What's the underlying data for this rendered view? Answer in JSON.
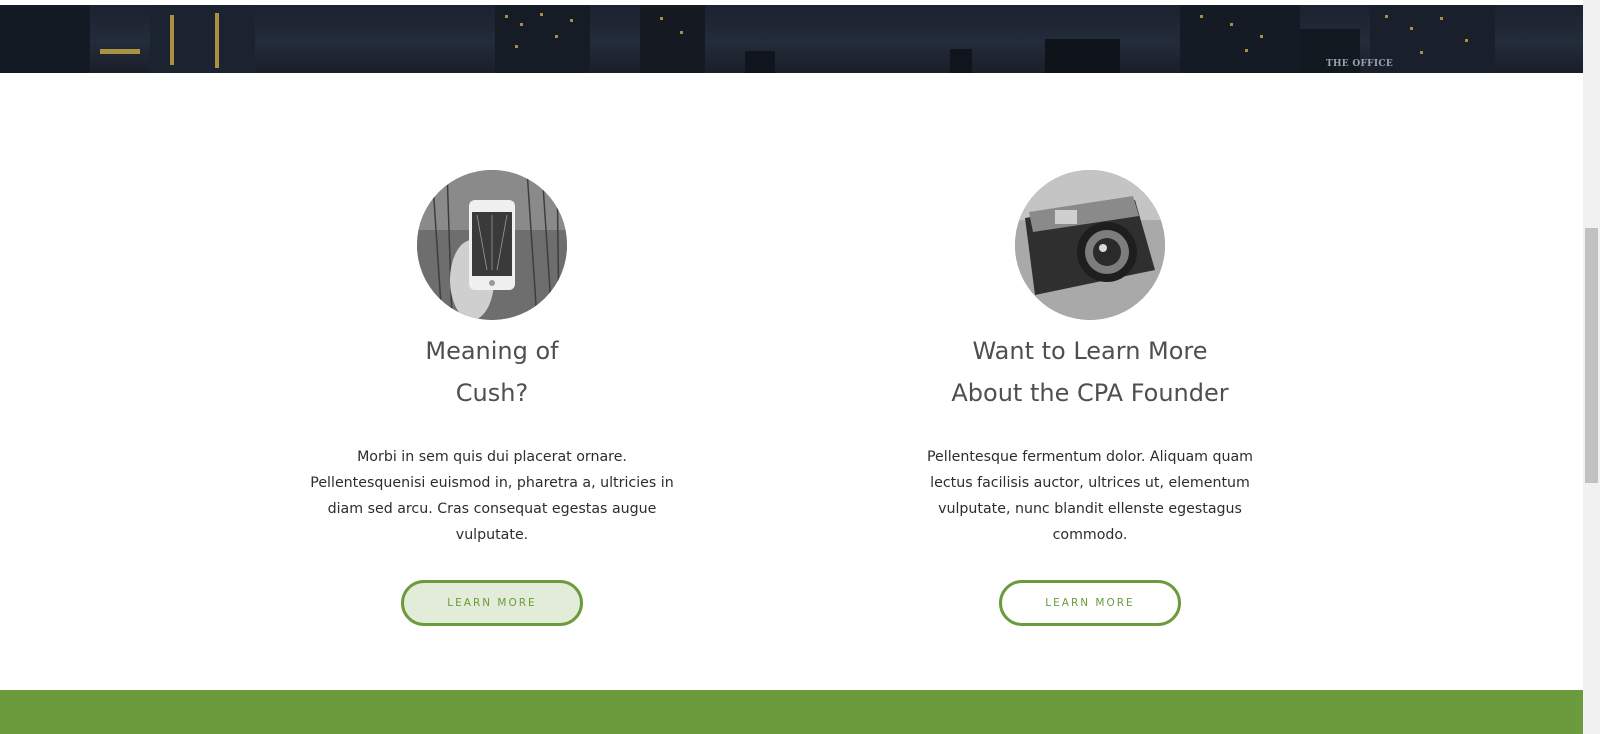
{
  "banner": {
    "sign_text": "THE OFFICE",
    "colors": {
      "sky": "#1b2230",
      "windows": "#d8b54a"
    }
  },
  "features": [
    {
      "image_icon": "smartphone-photo-icon",
      "title_line1": "Meaning of",
      "title_line2": "Cush?",
      "text": "Morbi in sem quis dui placerat ornare. Pellentesquenisi euismod in, pharetra a, ultricies in diam sed arcu. Cras consequat egestas augue vulputate.",
      "button_label": "LEARN MORE"
    },
    {
      "image_icon": "camera-photo-icon",
      "title_line1": "Want to Learn More",
      "title_line2": "About the CPA Founder",
      "text": "Pellentesque fermentum dolor. Aliquam quam lectus facilisis auctor, ultrices ut, elementum vulputate, nunc blandit ellenste egestagus commodo.",
      "button_label": "LEARN MORE"
    }
  ],
  "colors": {
    "accent_green": "#6b9b3c",
    "button_hover_bg": "#e3ecd8",
    "title": "#4f4f4f",
    "body_text": "#2d2d2d"
  }
}
